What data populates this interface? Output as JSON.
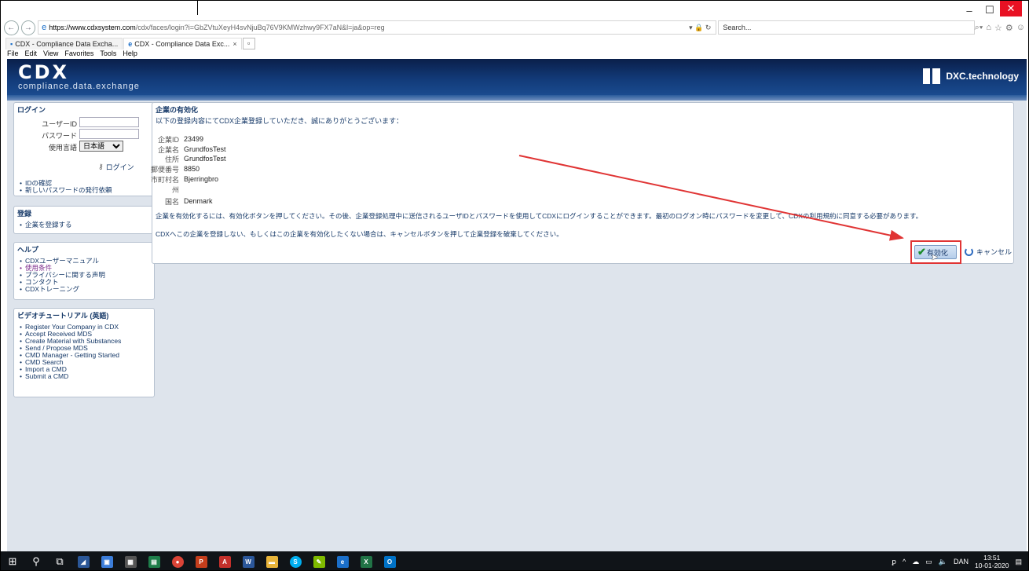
{
  "window": {
    "minimize": "–",
    "maximize": "☐",
    "close": "✕"
  },
  "browser": {
    "url_host": "https://www.cdxsystem.com",
    "url_path": "/cdx/faces/login?i=GbZVtuXeyH4svNjuBq76V9KMWzhwy9FX7aN&l=ja&op=reg",
    "search_placeholder": "Search...",
    "tabs": [
      {
        "label": "CDX - Compliance Data Excha...",
        "active": false
      },
      {
        "label": "CDX - Compliance Data Exc...",
        "active": true
      }
    ],
    "menu": [
      "File",
      "Edit",
      "View",
      "Favorites",
      "Tools",
      "Help"
    ]
  },
  "header": {
    "logo_mark": "CDX",
    "logo_sub": "compliance.data.exchange",
    "partner": "DXC.technology"
  },
  "login": {
    "title": "ログイン",
    "user_id_label": "ユーザーID",
    "user_id_value": "",
    "password_label": "パスワード",
    "language_label": "使用言語",
    "language_value": "日本語",
    "login_button": "ログイン",
    "links": [
      "IDの確認",
      "新しいパスワードの発行依頼"
    ]
  },
  "register": {
    "title": "登録",
    "links": [
      "企業を登録する"
    ]
  },
  "help": {
    "title": "ヘルプ",
    "links": [
      "CDXユーザーマニュアル",
      "使用条件",
      "プライバシーに関する声明",
      "コンタクト",
      "CDXトレーニング"
    ]
  },
  "videos": {
    "title": "ビデオチュートリアル (英語)",
    "links": [
      "Register Your Company in CDX",
      "Accept Received MDS",
      "Create Material with Substances",
      "Send / Propose MDS",
      "CMD Manager - Getting Started",
      "CMD Search",
      "Import a CMD",
      "Submit a CMD"
    ]
  },
  "main": {
    "title": "企業の有効化",
    "intro": "以下の登録内容にてCDX企業登録していただき、誠にありがとうございます：",
    "fields": [
      {
        "label": "企業ID",
        "value": "23499"
      },
      {
        "label": "企業名",
        "value": "GrundfosTest"
      },
      {
        "label": "住所",
        "value": "GrundfosTest"
      },
      {
        "label": "郵便番号",
        "value": "8850"
      },
      {
        "label": "市町村名",
        "value": "Bjerringbro"
      },
      {
        "label": "州",
        "value": ""
      },
      {
        "label": "国名",
        "value": "Denmark"
      }
    ],
    "instructions": "企業を有効化するには、有効化ボタンを押してください。その後、企業登録処理中に送信されるユーザIDとパスワードを使用してCDXにログインすることができます。最初のログオン時にパスワードを変更して、CDXの利用規約に同意する必要があります。",
    "cancel_note": "CDXへこの企業を登録しない、もしくはこの企業を有効化したくない場合は、キャンセルボタンを押して企業登録を破棄してください。",
    "activate_button": "有効化",
    "cancel_button": "キャンセル"
  },
  "taskbar": {
    "lang": "DAN",
    "time": "13:51",
    "date": "10-01-2020"
  },
  "colors": {
    "accent": "#163968",
    "highlight": "#e03434",
    "taskbar": "#101418"
  }
}
